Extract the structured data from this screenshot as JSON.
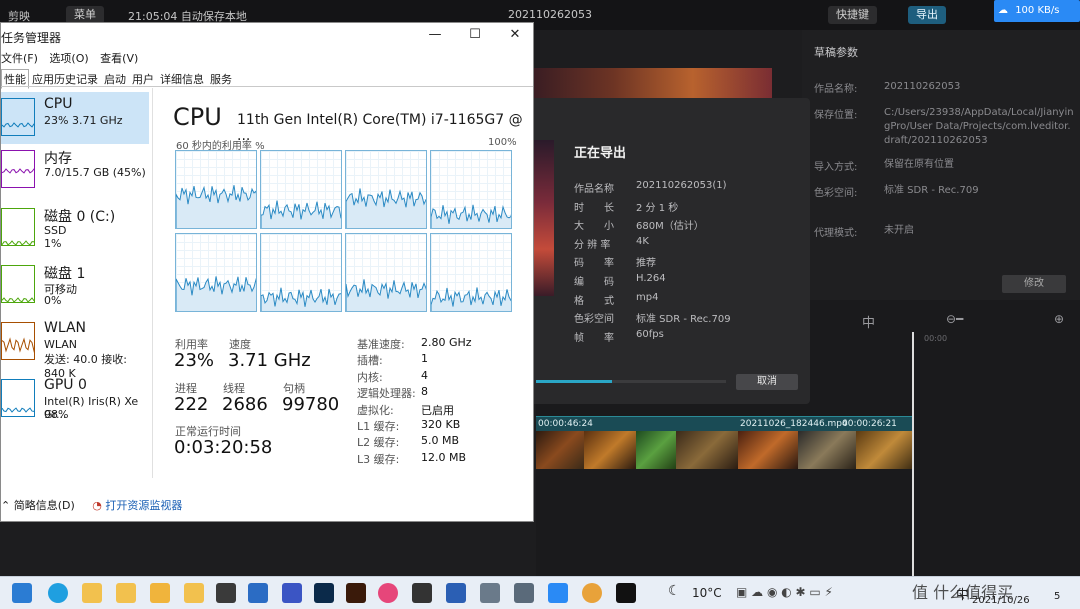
{
  "editor": {
    "app_name": "剪映",
    "menu_label": "菜单",
    "autosave": "21:05:04 自动保存本地",
    "project_title": "202110262053",
    "shortcut_label": "快捷键",
    "export_label": "导出",
    "net_speed": "100 KB/s",
    "draft_panel": {
      "title": "草稿参数",
      "rows": [
        {
          "key": "作品名称:",
          "value": "202110262053"
        },
        {
          "key": "保存位置:",
          "value": "C:/Users/23938/AppData/Local/JianyingPro/User Data/Projects/com.lveditor.draft/202110262053"
        },
        {
          "key": "导入方式:",
          "value": "保留在原有位置"
        },
        {
          "key": "色彩空间:",
          "value": "标准 SDR - Rec.709"
        },
        {
          "key": "代理模式:",
          "value": "未开启"
        }
      ],
      "modify_label": "修改"
    },
    "timeline": {
      "clip1_time": "00:00:46:24",
      "clip2_name": "20211026_182446.mp4",
      "clip2_time": "00:00:26:21",
      "ruler_time": "00:00"
    }
  },
  "export_dialog": {
    "title": "正在导出",
    "rows": [
      {
        "key": "作品名称",
        "value": "202110262053(1)"
      },
      {
        "key": "时　　长",
        "value": "2 分 1 秒"
      },
      {
        "key": "大　　小",
        "value": "680M（估计）"
      },
      {
        "key": "分 辨 率",
        "value": "4K"
      },
      {
        "key": "码　　率",
        "value": "推荐"
      },
      {
        "key": "编　　码",
        "value": "H.264"
      },
      {
        "key": "格　　式",
        "value": "mp4"
      },
      {
        "key": "色彩空间",
        "value": "标准 SDR - Rec.709"
      },
      {
        "key": "帧　　率",
        "value": "60fps"
      }
    ],
    "progress": 0.4,
    "cancel_label": "取消"
  },
  "task_manager": {
    "title": "任务管理器",
    "menu": [
      "文件(F)",
      "选项(O)",
      "查看(V)"
    ],
    "tabs": [
      "性能",
      "应用历史记录",
      "启动",
      "用户",
      "详细信息",
      "服务"
    ],
    "sidebar": [
      {
        "name": "CPU",
        "sub1": "23%  3.71 GHz",
        "sub2": "",
        "color": "#117dbb"
      },
      {
        "name": "内存",
        "sub1": "7.0/15.7 GB (45%)",
        "sub2": "",
        "color": "#8b12ae"
      },
      {
        "name": "磁盘 0 (C:)",
        "sub1": "SSD",
        "sub2": "1%",
        "color": "#4da60c"
      },
      {
        "name": "磁盘 1",
        "sub1": "可移动",
        "sub2": "0%",
        "color": "#4da60c"
      },
      {
        "name": "WLAN",
        "sub1": "WLAN",
        "sub2": "发送: 40.0  接收: 840 K",
        "color": "#a74f01"
      },
      {
        "name": "GPU 0",
        "sub1": "Intel(R) Iris(R) Xe Gr...",
        "sub2": "98%",
        "color": "#117dbb"
      }
    ],
    "cpu_title": "CPU",
    "cpu_model": "11th Gen Intel(R) Core(TM) i7-1165G7 @ ...",
    "graph_caption": "60 秒内的利用率 %",
    "graph_max": "100%",
    "stats": {
      "util_label": "利用率",
      "util_value": "23%",
      "speed_label": "速度",
      "speed_value": "3.71 GHz",
      "proc_label": "进程",
      "proc_value": "222",
      "thread_label": "线程",
      "thread_value": "2686",
      "handle_label": "句柄",
      "handle_value": "99780",
      "uptime_label": "正常运行时间",
      "uptime_value": "0:03:20:58"
    },
    "specs": [
      {
        "key": "基准速度:",
        "value": "2.80 GHz"
      },
      {
        "key": "插槽:",
        "value": "1"
      },
      {
        "key": "内核:",
        "value": "4"
      },
      {
        "key": "逻辑处理器:",
        "value": "8"
      },
      {
        "key": "虚拟化:",
        "value": "已启用"
      },
      {
        "key": "L1 缓存:",
        "value": "320 KB"
      },
      {
        "key": "L2 缓存:",
        "value": "5.0 MB"
      },
      {
        "key": "L3 缓存:",
        "value": "12.0 MB"
      }
    ],
    "fewer_details": "简略信息(D)",
    "open_monitor": "打开资源监视器"
  },
  "taskbar": {
    "temperature": "10°C",
    "date": "2021/10/26",
    "ime": "中",
    "watermark": "值 什么值得买",
    "notifications": "5"
  }
}
